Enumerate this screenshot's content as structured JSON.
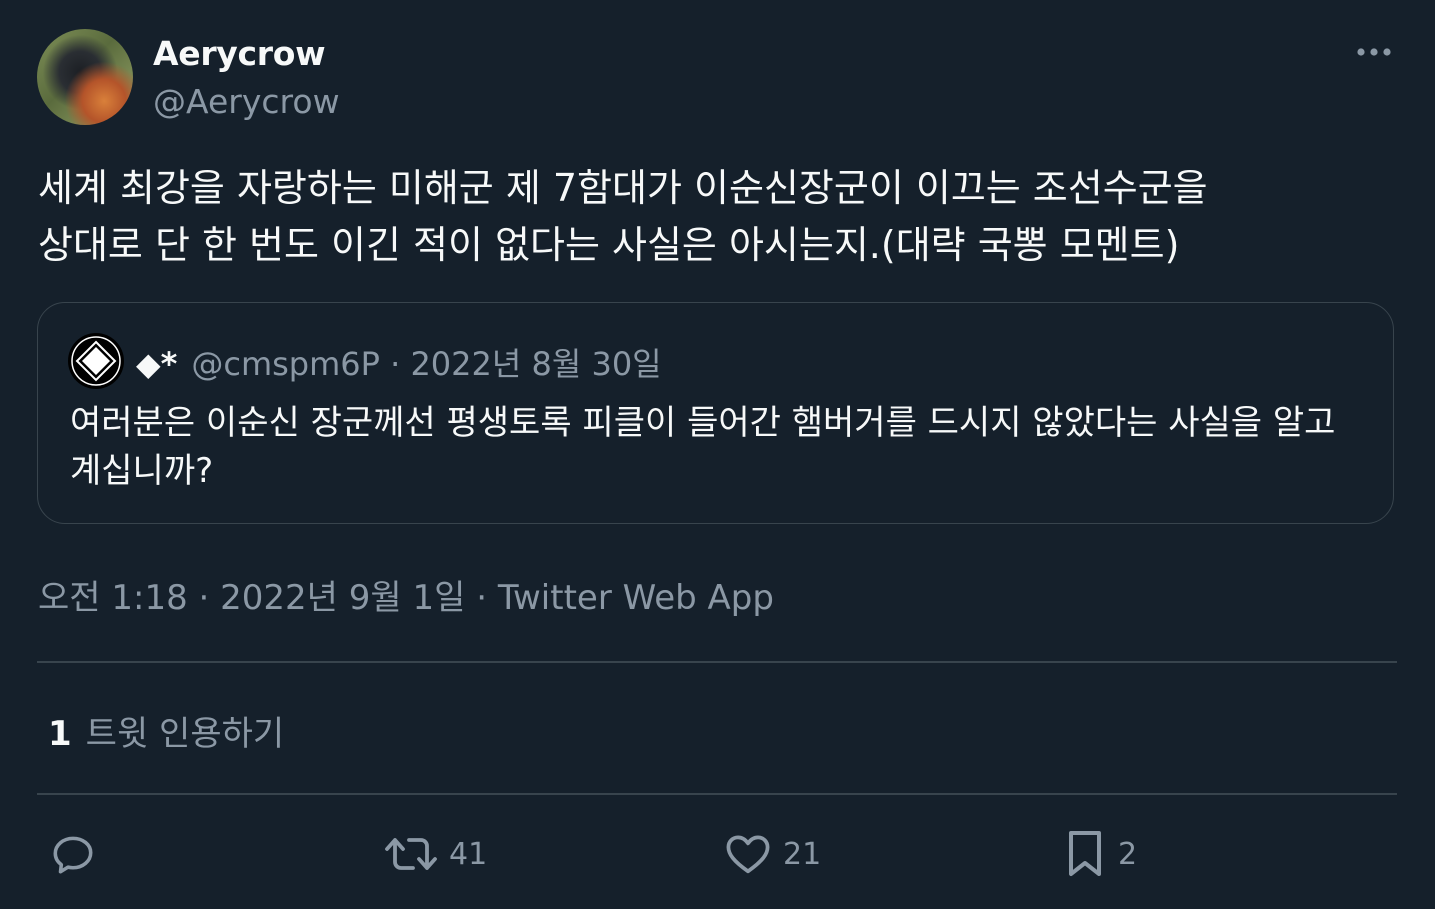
{
  "author": {
    "display_name": "Aerycrow",
    "handle": "@Aerycrow"
  },
  "tweet": {
    "text": "세계 최강을 자랑하는 미해군 제 7함대가 이순신장군이 이끄는 조선수군을\n상대로 단 한 번도 이긴 적이 없다는 사실은 아시는지.(대략 국뽕 모멘트)"
  },
  "quoted_tweet": {
    "display_name": "◆*",
    "handle": "@cmspm6P",
    "date": "2022년 8월 30일",
    "text": "여러분은 이순신 장군께선 평생토록 피클이 들어간 햄버거를 드시지 않았다는 사실을 알고 계십니까?"
  },
  "meta": {
    "time": "오전 1:18",
    "date": "2022년 9월 1일",
    "source": "Twitter Web App"
  },
  "stats": {
    "quote_count": "1",
    "quote_label": "트윗 인용하기"
  },
  "actions": {
    "retweet_count": "41",
    "like_count": "21",
    "bookmark_count": "2"
  },
  "icons": {
    "more": "more-horizontal-icon",
    "reply": "reply-icon",
    "retweet": "retweet-icon",
    "like": "heart-icon",
    "bookmark": "bookmark-icon"
  },
  "colors": {
    "background": "#15202b",
    "text": "#f7f9f9",
    "secondary": "#8b98a5",
    "border": "#38444d"
  }
}
